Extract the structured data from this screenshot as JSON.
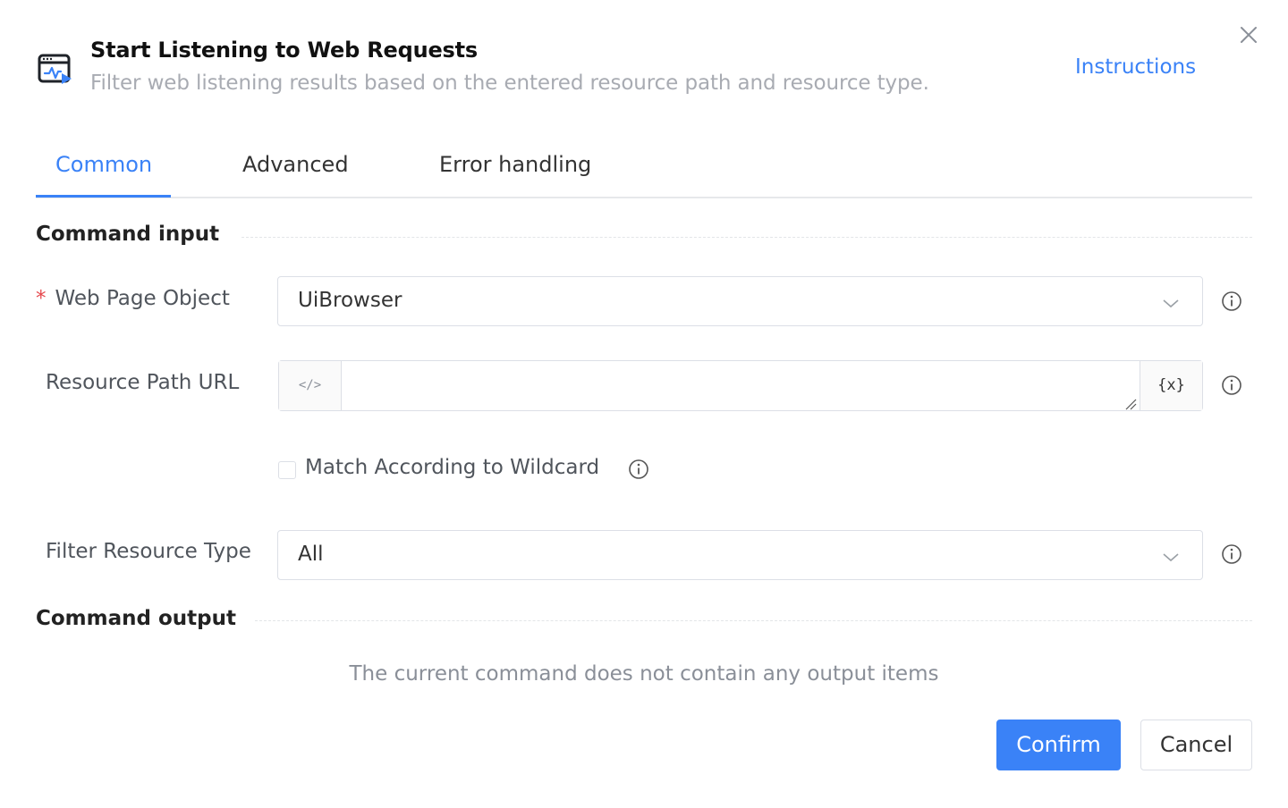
{
  "dialog": {
    "title": "Start Listening to Web Requests",
    "subtitle": "Filter web listening results based on the entered resource path and resource type.",
    "instructions_label": "Instructions",
    "close_icon": "close-icon",
    "header_icon": "browser-monitor-icon"
  },
  "tabs": [
    {
      "label": "Common",
      "active": true
    },
    {
      "label": "Advanced",
      "active": false
    },
    {
      "label": "Error handling",
      "active": false
    }
  ],
  "sections": {
    "input_title": "Command input",
    "output_title": "Command output",
    "output_empty_text": "The current command does not contain any output items"
  },
  "fields": {
    "web_page_object": {
      "label": "Web Page Object",
      "required": true,
      "required_mark": "*",
      "value": "UiBrowser"
    },
    "resource_path_url": {
      "label": "Resource Path URL",
      "prefix_icon": "</>",
      "value": "",
      "variable_button": "{x}"
    },
    "wildcard": {
      "label": "Match According to Wildcard",
      "checked": false
    },
    "filter_resource_type": {
      "label": "Filter Resource Type",
      "value": "All"
    }
  },
  "buttons": {
    "confirm": "Confirm",
    "cancel": "Cancel"
  },
  "colors": {
    "accent": "#3a82f7",
    "required": "#e5484d",
    "muted_text": "#a8abb2"
  }
}
